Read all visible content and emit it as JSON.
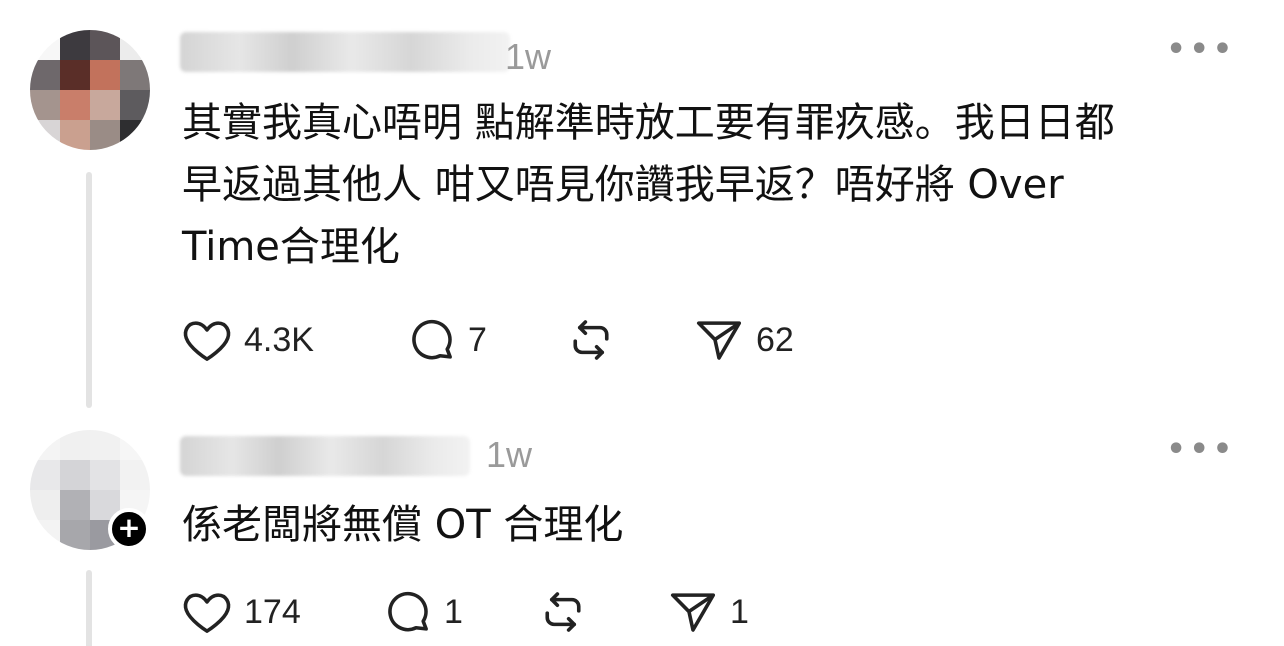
{
  "posts": [
    {
      "time": "1w",
      "text": "其實我真心唔明 點解準時放工要有罪疚感。我日日都\n早返過其他人 咁又唔見你讚我早返？唔好將 Over\nTime合理化",
      "likes": "4.3K",
      "replies": "7",
      "shares": "62",
      "avatar_colors": [
        "#f7f7f7",
        "#3d3a3f",
        "#5c5559",
        "#ececec",
        "#6e686b",
        "#5a2e28",
        "#c2725c",
        "#7e7878",
        "#a4948e",
        "#c97e6a",
        "#c8a89c",
        "#5d5b5e",
        "#d8d5d6",
        "#caa08f",
        "#9a8c86",
        "#2e2e30"
      ]
    },
    {
      "time": "1w",
      "text": "係老闆將無償 OT 合理化",
      "likes": "174",
      "replies": "1",
      "shares": "1",
      "follow_badge": "+",
      "avatar_colors": [
        "#f4f4f4",
        "#f0f0f0",
        "#f1f1f1",
        "#f6f6f6",
        "#e8e8ea",
        "#d4d4d7",
        "#e3e3e5",
        "#f2f2f2",
        "#eeeeee",
        "#b1b1b5",
        "#d9d9dc",
        "#f5f5f5",
        "#f3f3f3",
        "#a7a7ab",
        "#9a9aa0",
        "#f7f7f7"
      ]
    }
  ],
  "icons": {
    "like": "heart-icon",
    "reply": "comment-icon",
    "repost": "repost-icon",
    "share": "send-icon",
    "more": "more-options-icon"
  }
}
